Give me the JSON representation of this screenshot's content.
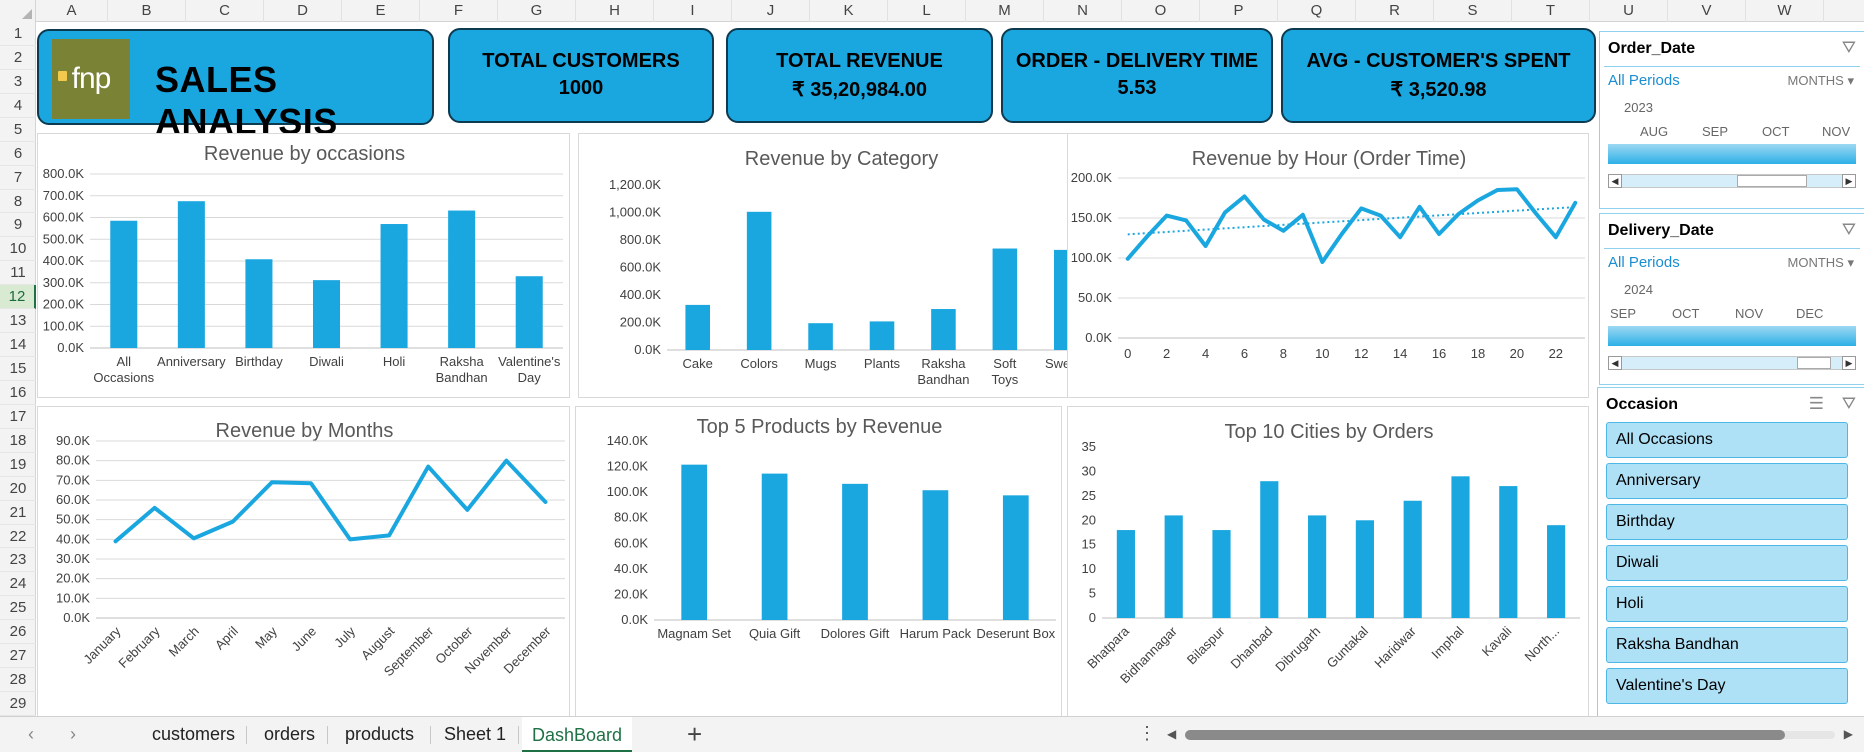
{
  "app": {
    "title": "SALES ANALYSIS",
    "logo_text": "fnp"
  },
  "kpis": [
    {
      "title": "TOTAL CUSTOMERS",
      "value": "1000"
    },
    {
      "title": "TOTAL REVENUE",
      "value": "₹ 35,20,984.00"
    },
    {
      "title": "ORDER - DELIVERY TIME",
      "value": "5.53"
    },
    {
      "title": "AVG - CUSTOMER'S SPENT",
      "value": "₹ 3,520.98"
    }
  ],
  "grid": {
    "columns": [
      "A",
      "B",
      "C",
      "D",
      "E",
      "F",
      "G",
      "H",
      "I",
      "J",
      "K",
      "L",
      "M",
      "N",
      "O",
      "P",
      "Q",
      "R",
      "S",
      "T",
      "U",
      "V",
      "W"
    ],
    "rows": [
      "1",
      "2",
      "3",
      "4",
      "5",
      "6",
      "7",
      "8",
      "9",
      "10",
      "11",
      "12",
      "13",
      "14",
      "15",
      "16",
      "17",
      "18",
      "19",
      "20",
      "21",
      "22",
      "23",
      "24",
      "25",
      "26",
      "27",
      "28",
      "29"
    ],
    "selected_row": "12"
  },
  "chart_data": [
    {
      "id": "occasions",
      "type": "bar",
      "title": "Revenue by occasions",
      "categories": [
        "All Occasions",
        "Anniversary",
        "Birthday",
        "Diwali",
        "Holi",
        "Raksha Bandhan",
        "Valentine's Day"
      ],
      "category_lines": [
        [
          "All",
          "Occasions"
        ],
        [
          "Anniversary"
        ],
        [
          "Birthday"
        ],
        [
          "Diwali"
        ],
        [
          "Holi"
        ],
        [
          "Raksha",
          "Bandhan"
        ],
        [
          "Valentine's",
          "Day"
        ]
      ],
      "values": [
        585000,
        675000,
        408000,
        312000,
        570000,
        632000,
        330000
      ],
      "ylim": [
        0,
        800000
      ],
      "yticks": [
        "0.0K",
        "100.0K",
        "200.0K",
        "300.0K",
        "400.0K",
        "500.0K",
        "600.0K",
        "700.0K",
        "800.0K"
      ],
      "grid": true,
      "color": "#1aa7e0"
    },
    {
      "id": "category",
      "type": "bar",
      "title": "Revenue by Category",
      "categories": [
        "Cake",
        "Colors",
        "Mugs",
        "Plants",
        "Raksha Bandhan",
        "Soft Toys",
        "Sweets"
      ],
      "category_lines": [
        [
          "Cake"
        ],
        [
          "Colors"
        ],
        [
          "Mugs"
        ],
        [
          "Plants"
        ],
        [
          "Raksha",
          "Bandhan"
        ],
        [
          "Soft",
          "Toys"
        ],
        [
          "Sweets"
        ]
      ],
      "values": [
        328000,
        1005000,
        195000,
        208000,
        298000,
        738000,
        728000
      ],
      "ylim": [
        0,
        1200000
      ],
      "yticks": [
        "0.0K",
        "200.0K",
        "400.0K",
        "600.0K",
        "800.0K",
        "1,000.0K",
        "1,200.0K"
      ],
      "grid": false,
      "color": "#1aa7e0"
    },
    {
      "id": "hour",
      "type": "line",
      "title": "Revenue by Hour (Order Time)",
      "x": [
        0,
        1,
        2,
        3,
        4,
        5,
        6,
        7,
        8,
        9,
        10,
        11,
        12,
        13,
        14,
        15,
        16,
        17,
        18,
        19,
        20,
        21,
        22,
        23
      ],
      "values": [
        99000,
        127000,
        153000,
        147000,
        115000,
        157000,
        177000,
        148000,
        134000,
        154000,
        95000,
        130000,
        162000,
        153000,
        126000,
        164000,
        130000,
        155000,
        172000,
        185000,
        186000,
        155000,
        126000,
        169000
      ],
      "trendline": true,
      "xticks": [
        "0",
        "2",
        "4",
        "6",
        "8",
        "10",
        "12",
        "14",
        "16",
        "18",
        "20",
        "22"
      ],
      "ylim": [
        0,
        200000
      ],
      "yticks": [
        "0.0K",
        "50.0K",
        "100.0K",
        "150.0K",
        "200.0K"
      ],
      "grid": true,
      "color": "#1aa7e0"
    },
    {
      "id": "months",
      "type": "line",
      "title": "Revenue by Months",
      "categories": [
        "January",
        "February",
        "March",
        "April",
        "May",
        "June",
        "July",
        "August",
        "September",
        "October",
        "November",
        "December"
      ],
      "values": [
        39000,
        56000,
        40500,
        49000,
        69000,
        68500,
        40000,
        42000,
        77000,
        55000,
        80000,
        59000
      ],
      "ylim": [
        0,
        90000
      ],
      "yticks": [
        "0.0K",
        "10.0K",
        "20.0K",
        "30.0K",
        "40.0K",
        "50.0K",
        "60.0K",
        "70.0K",
        "80.0K",
        "90.0K"
      ],
      "grid": true,
      "color": "#1aa7e0"
    },
    {
      "id": "products",
      "type": "bar",
      "title": "Top 5 Products by Revenue",
      "categories": [
        "Magnam Set",
        "Quia Gift",
        "Dolores Gift",
        "Harum Pack",
        "Deserunt Box"
      ],
      "category_lines": [
        [
          "Magnam Set"
        ],
        [
          "Quia Gift"
        ],
        [
          "Dolores Gift"
        ],
        [
          "Harum Pack"
        ],
        [
          "Deserunt Box"
        ]
      ],
      "values": [
        121500,
        114500,
        106500,
        101500,
        97500
      ],
      "ylim": [
        0,
        140000
      ],
      "yticks": [
        "0.0K",
        "20.0K",
        "40.0K",
        "60.0K",
        "80.0K",
        "100.0K",
        "120.0K",
        "140.0K"
      ],
      "grid": false,
      "color": "#1aa7e0"
    },
    {
      "id": "cities",
      "type": "bar",
      "title": "Top 10 Cities by Orders",
      "categories": [
        "Bhatpara",
        "Bidhannagar",
        "Bilaspur",
        "Dhanbad",
        "Dibrugarh",
        "Guntakal",
        "Haridwar",
        "Imphal",
        "Kavali",
        "North..."
      ],
      "values": [
        18,
        21,
        18,
        28,
        21,
        20,
        24,
        29,
        27,
        19
      ],
      "ylim": [
        0,
        35
      ],
      "yticks": [
        "0",
        "5",
        "10",
        "15",
        "20",
        "25",
        "30",
        "35"
      ],
      "grid": false,
      "color": "#1aa7e0"
    }
  ],
  "slicers": {
    "order_date": {
      "title": "Order_Date",
      "all_periods": "All Periods",
      "unit": "MONTHS",
      "year": "2023",
      "months": [
        "AUG",
        "SEP",
        "OCT",
        "NOV"
      ]
    },
    "delivery_date": {
      "title": "Delivery_Date",
      "all_periods": "All Periods",
      "unit": "MONTHS",
      "year": "2024",
      "months": [
        "SEP",
        "OCT",
        "NOV",
        "DEC"
      ]
    },
    "occasion": {
      "title": "Occasion",
      "items": [
        "All Occasions",
        "Anniversary",
        "Birthday",
        "Diwali",
        "Holi",
        "Raksha Bandhan",
        "Valentine's Day"
      ]
    }
  },
  "tabs": {
    "sheets": [
      "customers",
      "orders",
      "products",
      "Sheet 1",
      "DashBoard"
    ],
    "active": "DashBoard"
  }
}
